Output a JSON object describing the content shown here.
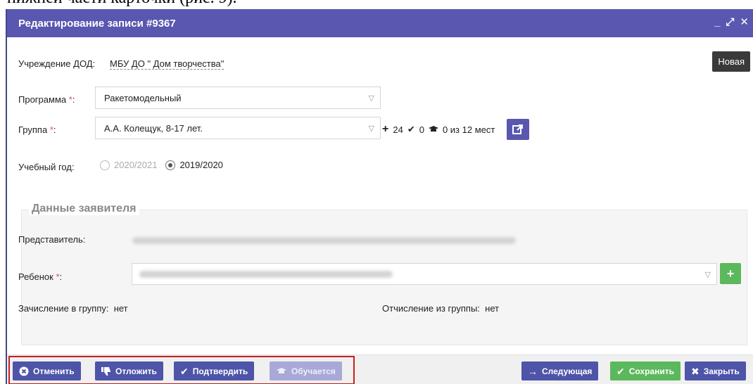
{
  "caption": {
    "text": "нижней части карточки (рис. 9)."
  },
  "window": {
    "title": "Редактирование записи #9367",
    "controls": {
      "minimize": "_",
      "maximize": "⤢",
      "close": "✕"
    }
  },
  "form": {
    "institution": {
      "label": "Учреждение ДОД:",
      "value": "МБУ ДО \" Дом творчества\""
    },
    "status_badge": "Новая",
    "program": {
      "label": "Программа",
      "required_mark": "*",
      "colon": ":",
      "value": "Ракетомодельный"
    },
    "group": {
      "label": "Группа",
      "required_mark": "*",
      "colon": ":",
      "value": "А.А. Колещук, 8-17 лет.",
      "stats": {
        "plus": "24",
        "check": "0",
        "cap": "0 из 12 мест"
      }
    },
    "study_year": {
      "label": "Учебный год:",
      "options": [
        {
          "label": "2020/2021",
          "selected": false
        },
        {
          "label": "2019/2020",
          "selected": true
        }
      ]
    }
  },
  "applicant": {
    "legend": "Данные заявителя",
    "representative_label": "Представитель:",
    "child": {
      "label": "Ребенок",
      "required_mark": "*",
      "colon": ":"
    },
    "enrollment": {
      "label": "Зачисление в группу:",
      "value": "нет"
    },
    "expulsion": {
      "label": "Отчисление из группы:",
      "value": "нет"
    }
  },
  "footer": {
    "left_buttons": [
      {
        "label": "Отменить",
        "icon": "times-circle-icon"
      },
      {
        "label": "Отложить",
        "icon": "thumbs-down-icon"
      },
      {
        "label": "Подтвердить",
        "icon": "check-icon"
      },
      {
        "label": "Обучается",
        "icon": "graduation-cap-icon",
        "disabled": true
      }
    ],
    "next": {
      "label": "Следующая",
      "icon": "arrow-right-icon"
    },
    "save": {
      "label": "Сохранить",
      "icon": "check-icon"
    },
    "close": {
      "label": "Закрыть",
      "icon": "close-icon"
    }
  },
  "colors": {
    "header": "#5a57b0",
    "button_primary": "#4e54a8",
    "button_success": "#5cb85c",
    "highlight": "#c81e1e",
    "status_badge": "#3a3a3a"
  }
}
